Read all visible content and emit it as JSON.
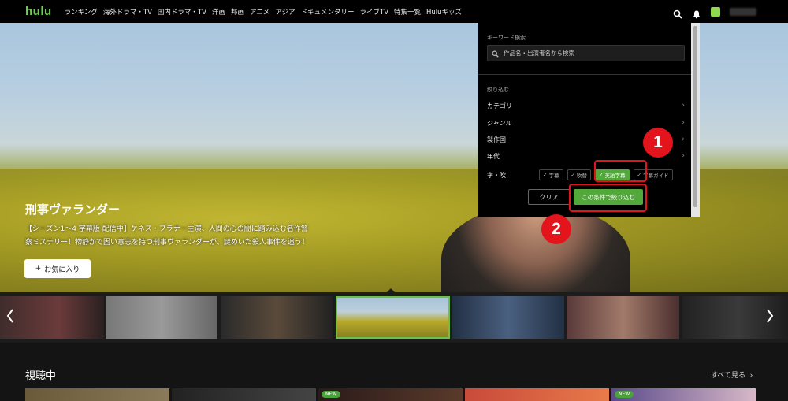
{
  "nav": {
    "logo": "hulu",
    "items": [
      "ランキング",
      "海外ドラマ・TV",
      "国内ドラマ・TV",
      "洋画",
      "邦画",
      "アニメ",
      "アジア",
      "ドキュメンタリー",
      "ライブTV",
      "特集一覧",
      "Huluキッズ"
    ]
  },
  "hero": {
    "title": "刑事ヴァランダー",
    "desc_line1": "【シーズン1～4 字幕版 配信中】ケネス・ブラナー主演、人間の心の闇に踏み込む名作警",
    "desc_line2": "察ミステリー！物静かで固い意志を持つ刑事ヴァランダーが、謎めいた殺人事件を追う！",
    "fav_label": "お気に入り",
    "fav_plus": "+"
  },
  "filter": {
    "keyword_label": "キーワード検索",
    "keyword_placeholder": "作品名・出演者名から検索",
    "narrow_label": "絞り込む",
    "rows": [
      "カテゴリ",
      "ジャンル",
      "製作国",
      "年代"
    ],
    "audio_label": "字・吹",
    "chips": [
      "字幕",
      "吹替",
      "英語字幕",
      "字幕ガイド"
    ],
    "clear_label": "クリア",
    "apply_label": "この条件で絞り込む"
  },
  "annotations": {
    "step1": "1",
    "step2": "2"
  },
  "section": {
    "title": "視聴中",
    "see_all": "すべて見る",
    "new_badge": "NEW"
  },
  "colors": {
    "brand_green": "#52a83a",
    "annotation_red": "#e0141b"
  }
}
